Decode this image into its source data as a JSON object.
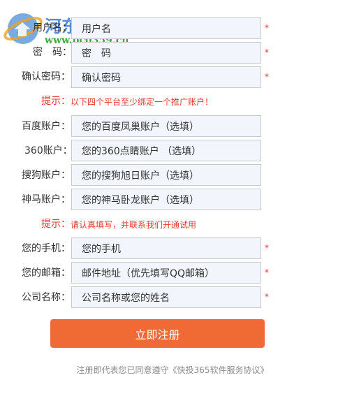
{
  "watermark": {
    "title": "河东软件园",
    "url": "www.pc0359.cn"
  },
  "form": {
    "fields": [
      {
        "label": "用户名：",
        "value": "用户名",
        "required": true
      },
      {
        "label": "密　码：",
        "value": "密　码",
        "required": true
      },
      {
        "label": "确认密码：",
        "value": "确认密码",
        "required": true
      }
    ],
    "hint1": {
      "label": "提示：",
      "text": "以下四个平台至少绑定一个推广账户！"
    },
    "platforms": [
      {
        "label": "百度账户：",
        "value": "您的百度凤巢账户（选填）"
      },
      {
        "label": "360账户：",
        "value": "您的360点睛账户 （选填）"
      },
      {
        "label": "搜狗账户：",
        "value": "您的搜狗旭日账户（选填）"
      },
      {
        "label": "神马账户：",
        "value": "您的神马卧龙账户（选填）"
      }
    ],
    "hint2": {
      "label": "提示：",
      "text": "请认真填写，并联系我们开通试用"
    },
    "contact": [
      {
        "label": "您的手机：",
        "value": "您的手机",
        "required": true
      },
      {
        "label": "您的邮箱：",
        "value": "邮件地址（优先填写QQ邮箱）",
        "required": true
      },
      {
        "label": "公司名称：",
        "value": "公司名称或您的姓名",
        "required": true
      }
    ],
    "required_mark": "*",
    "submit_label": "立即注册",
    "agreement": "注册即代表您已同意遵守《快投365软件服务协议》"
  },
  "colors": {
    "accent": "#f06a36",
    "required": "#e23a2e",
    "field_bg": "#f2f6fc",
    "watermark_blue": "#3d7bd1",
    "watermark_green": "#2aa22a"
  }
}
